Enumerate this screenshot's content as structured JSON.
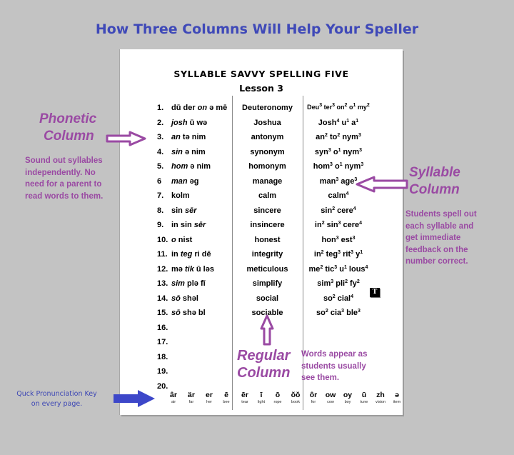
{
  "main_title": "How Three Columns Will Help Your Speller",
  "document": {
    "title": "SYLLABLE SAVVY SPELLING FIVE",
    "subtitle": "Lesson 3",
    "rows": [
      {
        "num": "1.",
        "phon_pre": "dū der ",
        "phon_it": "on",
        "phon_post": " ə mē",
        "regular": "Deuteronomy",
        "syllables": [
          [
            "Deu",
            "3"
          ],
          [
            "ter",
            "3"
          ],
          [
            "on",
            "2"
          ],
          [
            "o",
            "1"
          ],
          [
            "my",
            "2"
          ]
        ]
      },
      {
        "num": "2.",
        "phon_pre": "",
        "phon_it": "josh",
        "phon_post": " ū wə",
        "regular": "Joshua",
        "syllables": [
          [
            "Josh",
            "4"
          ],
          [
            "u",
            "1"
          ],
          [
            "a",
            "1"
          ]
        ]
      },
      {
        "num": "3.",
        "phon_pre": "",
        "phon_it": "an",
        "phon_post": " tə nim",
        "regular": "antonym",
        "syllables": [
          [
            "an",
            "2"
          ],
          [
            "to",
            "2"
          ],
          [
            "nym",
            "3"
          ]
        ]
      },
      {
        "num": "4.",
        "phon_pre": "",
        "phon_it": "sin",
        "phon_post": " ə nim",
        "regular": "synonym",
        "syllables": [
          [
            "syn",
            "3"
          ],
          [
            "o",
            "1"
          ],
          [
            "nym",
            "3"
          ]
        ]
      },
      {
        "num": "5.",
        "phon_pre": "",
        "phon_it": "hom",
        "phon_post": "  ə nim",
        "regular": "homonym",
        "syllables": [
          [
            "hom",
            "3"
          ],
          [
            "o",
            "1"
          ],
          [
            "nym",
            "3"
          ]
        ]
      },
      {
        "num": "6",
        "phon_pre": "",
        "phon_it": "man",
        "phon_post": " əg",
        "regular": "manage",
        "syllables": [
          [
            "man",
            "3"
          ],
          [
            "age",
            "3"
          ]
        ]
      },
      {
        "num": "7.",
        "phon_pre": "kolm",
        "phon_it": "",
        "phon_post": "",
        "regular": "calm",
        "syllables": [
          [
            "calm",
            "4"
          ]
        ]
      },
      {
        "num": "8.",
        "phon_pre": "sin ",
        "phon_it": "sēr",
        "phon_post": "",
        "regular": "sincere",
        "syllables": [
          [
            "sin",
            "2"
          ],
          [
            "cere",
            "4"
          ]
        ]
      },
      {
        "num": "9.",
        "phon_pre": "in sin ",
        "phon_it": "sēr",
        "phon_post": "",
        "regular": "insincere",
        "syllables": [
          [
            "in",
            "2"
          ],
          [
            "sin",
            "3"
          ],
          [
            "cere",
            "4"
          ]
        ]
      },
      {
        "num": "10.",
        "phon_pre": "",
        "phon_it": "o",
        "phon_post": " nist",
        "regular": "honest",
        "syllables": [
          [
            "hon",
            "3"
          ],
          [
            "est",
            "3"
          ]
        ]
      },
      {
        "num": "11.",
        "phon_pre": "in ",
        "phon_it": "teg",
        "phon_post": " ri dē",
        "regular": "integrity",
        "syllables": [
          [
            "in",
            "2"
          ],
          [
            "teg",
            "3"
          ],
          [
            "rit",
            "3"
          ],
          [
            "y",
            "1"
          ]
        ]
      },
      {
        "num": "12.",
        "phon_pre": "mə ",
        "phon_it": "tik",
        "phon_post": " ū ləs",
        "regular": "meticulous",
        "syllables": [
          [
            "me",
            "2"
          ],
          [
            "tic",
            "3"
          ],
          [
            "u",
            "1"
          ],
          [
            "lous",
            "4"
          ]
        ]
      },
      {
        "num": "13.",
        "phon_pre": "",
        "phon_it": "sim",
        "phon_post": " plə fī",
        "regular": "simplify",
        "syllables": [
          [
            "sim",
            "3"
          ],
          [
            "pli",
            "2"
          ],
          [
            "fy",
            "2"
          ]
        ]
      },
      {
        "num": "14.",
        "phon_pre": "",
        "phon_it": "sō",
        "phon_post": " shəl",
        "regular": "social",
        "syllables": [
          [
            "so",
            "2"
          ],
          [
            "cial",
            "4"
          ]
        ]
      },
      {
        "num": "15.",
        "phon_pre": "",
        "phon_it": "sō",
        "phon_post": " shə bl",
        "regular": "sociable",
        "syllables": [
          [
            "so",
            "2"
          ],
          [
            "cia",
            "3"
          ],
          [
            "ble",
            "3"
          ]
        ]
      },
      {
        "num": "16.",
        "phon_pre": "",
        "phon_it": "",
        "phon_post": "",
        "regular": "",
        "syllables": []
      },
      {
        "num": "17.",
        "phon_pre": "",
        "phon_it": "",
        "phon_post": "",
        "regular": "",
        "syllables": []
      },
      {
        "num": "18.",
        "phon_pre": "",
        "phon_it": "",
        "phon_post": "",
        "regular": "",
        "syllables": []
      },
      {
        "num": "19.",
        "phon_pre": "",
        "phon_it": "",
        "phon_post": "",
        "regular": "",
        "syllables": []
      },
      {
        "num": "20.",
        "phon_pre": "",
        "phon_it": "",
        "phon_post": "",
        "regular": "",
        "syllables": []
      }
    ],
    "text_icon_label": "T",
    "pronunciation_key": [
      {
        "symbol": "âr",
        "word": "air"
      },
      {
        "symbol": "är",
        "word": "far"
      },
      {
        "symbol": "er",
        "word": "her"
      },
      {
        "symbol": "ē",
        "word": "bee"
      },
      {
        "symbol": "ēr",
        "word": "tear"
      },
      {
        "symbol": "ī",
        "word": "light"
      },
      {
        "symbol": "ō",
        "word": "rope"
      },
      {
        "symbol": "ŏŏ",
        "word": "book"
      },
      {
        "symbol": "ôr",
        "word": "for"
      },
      {
        "symbol": "ow",
        "word": "cow"
      },
      {
        "symbol": "oy",
        "word": "boy"
      },
      {
        "symbol": "ū",
        "word": "tune"
      },
      {
        "symbol": "zh",
        "word": "vision"
      },
      {
        "symbol": "ə",
        "word": "item"
      }
    ]
  },
  "annotations": {
    "phonetic": {
      "title_line1": "Phonetic",
      "title_line2": "Column",
      "body": [
        "Sound out syllables",
        "independently.  No",
        "need for a parent to",
        "read words to them."
      ]
    },
    "syllable": {
      "title_line1": "Syllable",
      "title_line2": "Column",
      "body": [
        "Students spell out",
        "each syllable and",
        "get immediate",
        "feedback on the",
        "number correct."
      ]
    },
    "regular": {
      "title_line1": "Regular",
      "title_line2": "Column",
      "body": [
        "Words appear as",
        "students usually",
        "see them."
      ]
    },
    "key_note": [
      "Quck Pronunciation Key",
      "on every page."
    ]
  },
  "colors": {
    "title_blue": "#3f49b8",
    "annotation_purple": "#9a4aa3",
    "note_blue": "#3d47b4",
    "arrow_blue": "#3d47c9",
    "background": "#c3c3c3"
  }
}
